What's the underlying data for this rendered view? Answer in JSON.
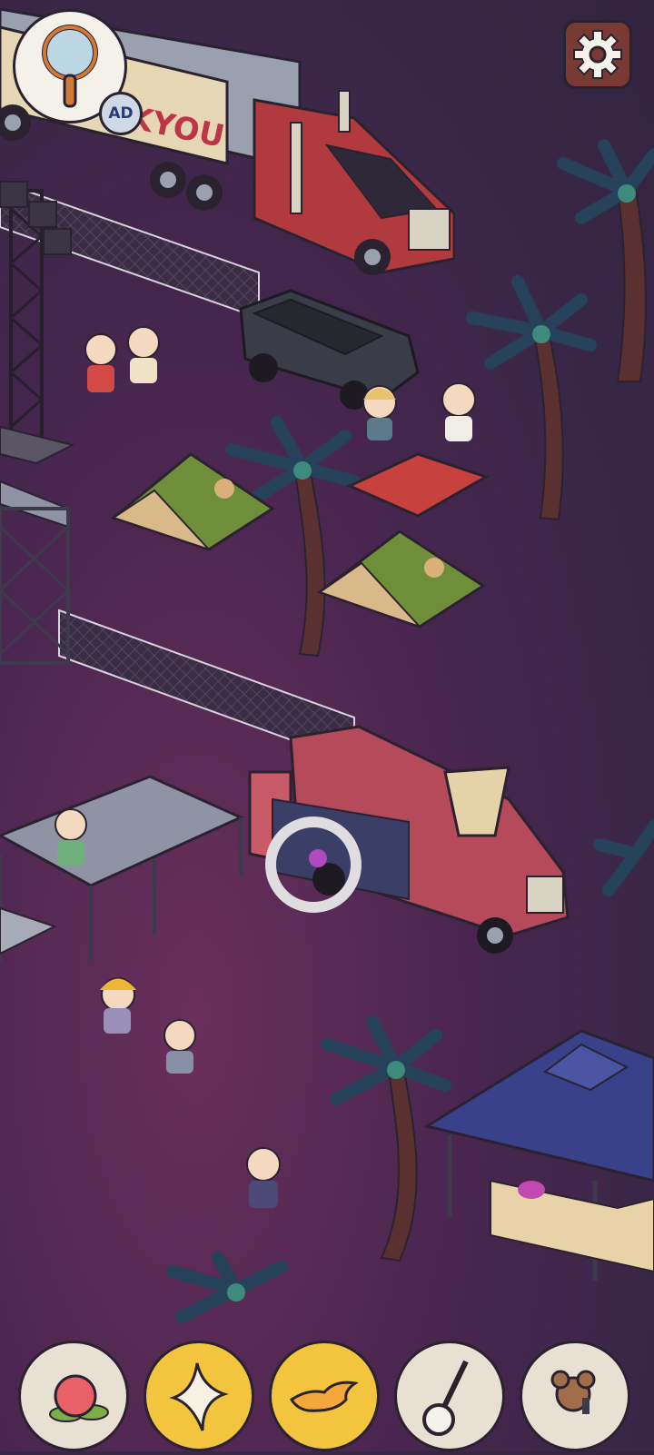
{
  "game": {
    "truck_banner_text": "KYOU",
    "ad_badge_label": "AD"
  },
  "hud": {
    "magnifier_icon": "magnifier-icon",
    "settings_icon": "gear-icon"
  },
  "items_bar": [
    {
      "name": "peach",
      "icon": "peach-icon",
      "state": "pending"
    },
    {
      "name": "sparkle-star",
      "icon": "star-icon",
      "state": "found"
    },
    {
      "name": "magic-lamp",
      "icon": "lamp-icon",
      "state": "found"
    },
    {
      "name": "banjo",
      "icon": "banjo-icon",
      "state": "pending"
    },
    {
      "name": "mouse-with-microphone",
      "icon": "mouse-icon",
      "state": "pending"
    }
  ],
  "colors": {
    "found_slot": "#f3c53e",
    "pending_slot": "#e8e0d3",
    "outline": "#2b2230"
  }
}
